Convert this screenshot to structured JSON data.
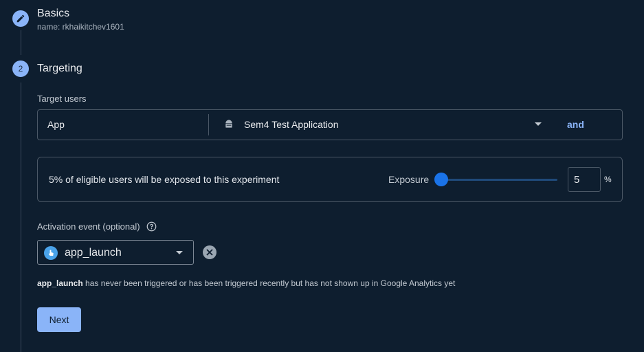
{
  "steps": {
    "basics": {
      "title": "Basics",
      "subtitle": "name: rkhaikitchev1601",
      "icon": "pencil-icon"
    },
    "targeting": {
      "number": "2",
      "title": "Targeting"
    }
  },
  "target_users": {
    "label": "Target users",
    "type_value": "App",
    "app_icon": "android-icon",
    "app_value": "Sem4 Test Application",
    "and_label": "and"
  },
  "exposure": {
    "description": "5% of eligible users will be exposed to this experiment",
    "label": "Exposure",
    "value_percent": 5,
    "input_value": "5",
    "unit": "%"
  },
  "activation": {
    "label": "Activation event (optional)",
    "help_icon": "help-icon",
    "event_icon": "touch-icon",
    "selected_event": "app_launch",
    "clear_icon": "clear-icon",
    "note_bold": "app_launch",
    "note_rest": " has never been triggered or has been triggered recently but has not shown up in Google Analytics yet"
  },
  "next_button": "Next",
  "colors": {
    "background": "#0e1e2f",
    "accent": "#8ab4f8",
    "slider": "#1a73e8"
  }
}
